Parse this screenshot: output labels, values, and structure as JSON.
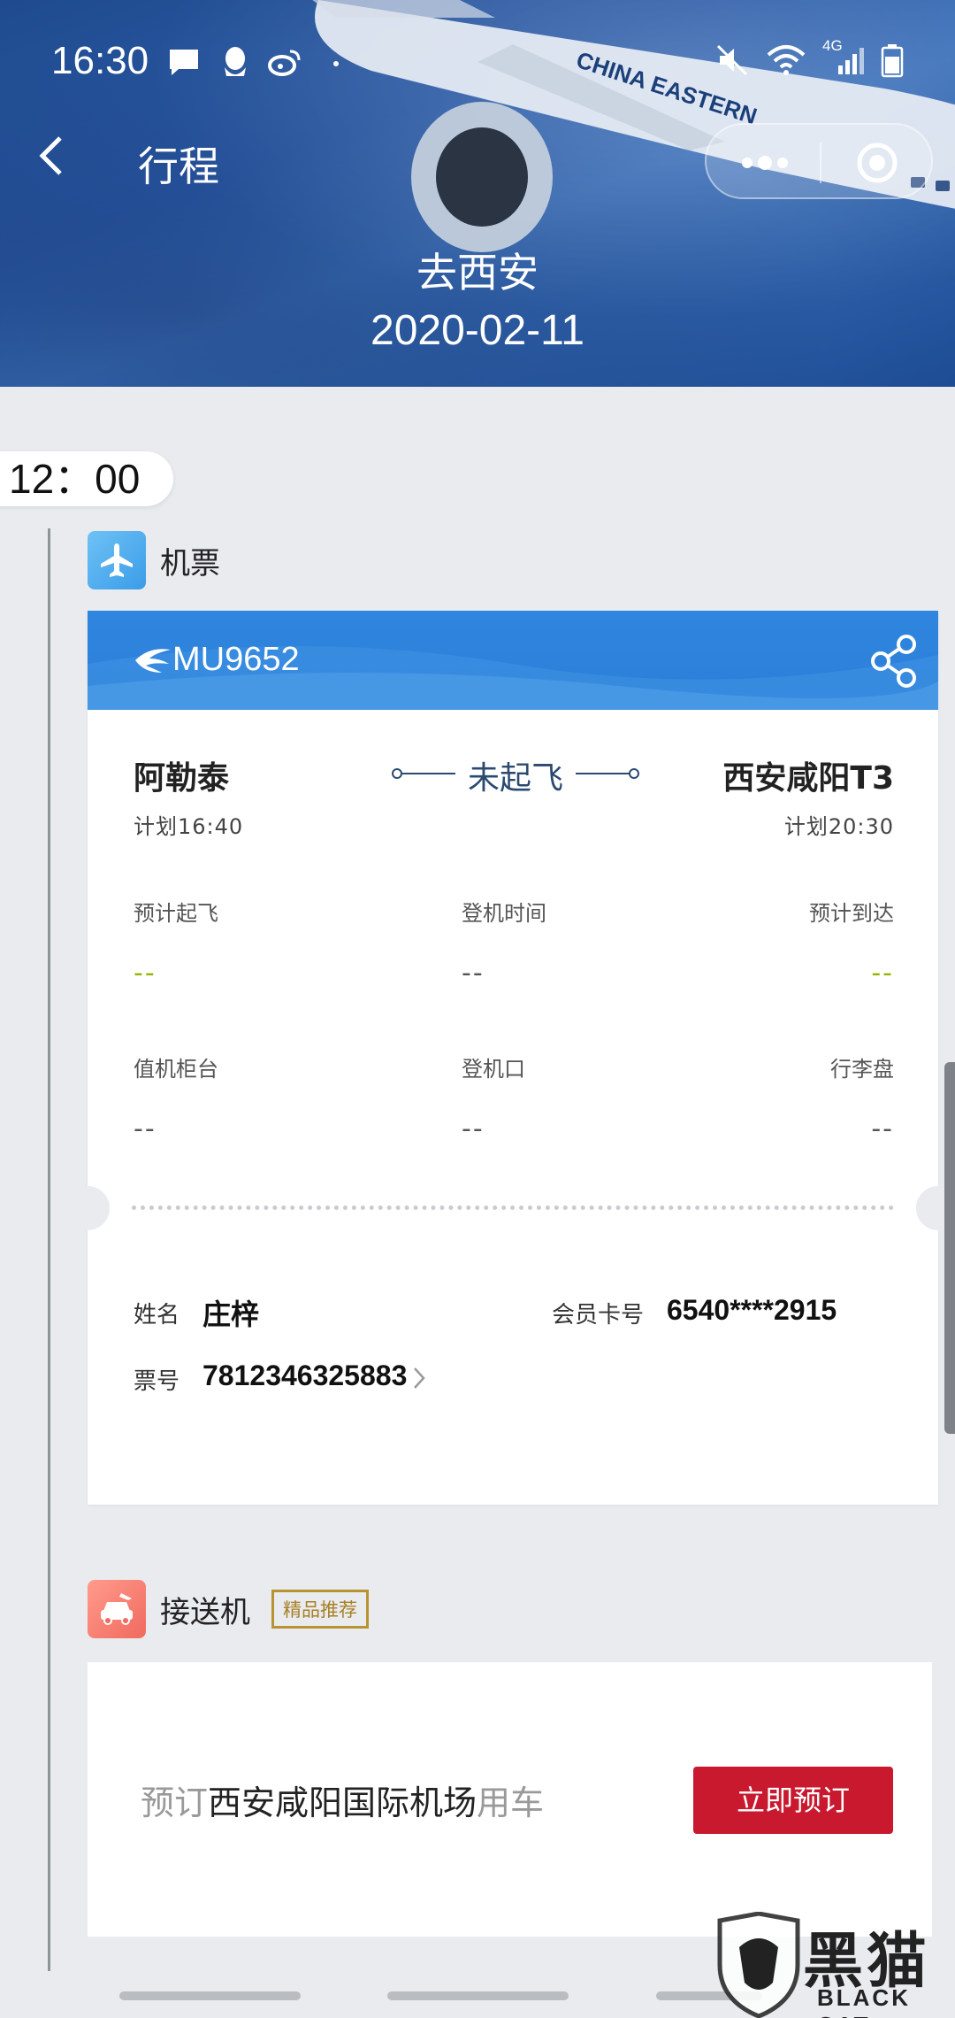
{
  "status_bar": {
    "time": "16:30",
    "network": "4G"
  },
  "nav": {
    "title": "行程"
  },
  "trip": {
    "destination": "去西安",
    "date": "2020-02-11"
  },
  "timeline": {
    "time": "12：00"
  },
  "flight_section": {
    "label": "机票",
    "flight_number": "MU9652",
    "origin": "阿勒泰",
    "destination": "西安咸阳T3",
    "status": "未起飞",
    "planned_departure": "计划16:40",
    "planned_arrival": "计划20:30",
    "est_departure_label": "预计起飞",
    "est_departure_value": "--",
    "boarding_time_label": "登机时间",
    "boarding_time_value": "--",
    "est_arrival_label": "预计到达",
    "est_arrival_value": "--",
    "checkin_counter_label": "值机柜台",
    "checkin_counter_value": "--",
    "gate_label": "登机口",
    "gate_value": "--",
    "baggage_label": "行李盘",
    "baggage_value": "--",
    "name_label": "姓名",
    "name_value": "庄梓",
    "member_label": "会员卡号",
    "member_value": "6540****2915",
    "ticket_label": "票号",
    "ticket_value": "7812346325883"
  },
  "transfer_section": {
    "label": "接送机",
    "badge": "精品推荐",
    "text_prefix": "预订",
    "text_airport": "西安咸阳国际机场",
    "text_suffix": "用车",
    "book_button": "立即预订"
  },
  "header_image": {
    "airline_text": "CHINA EASTERN"
  },
  "watermark": {
    "title": "黑猫",
    "subtitle": "BLACK CAT"
  },
  "colors": {
    "header_blue": "#2a5aa6",
    "ticket_blue": "#2f86de",
    "book_red": "#c8192e",
    "badge_gold": "#b89332",
    "est_green": "#9cb200"
  }
}
